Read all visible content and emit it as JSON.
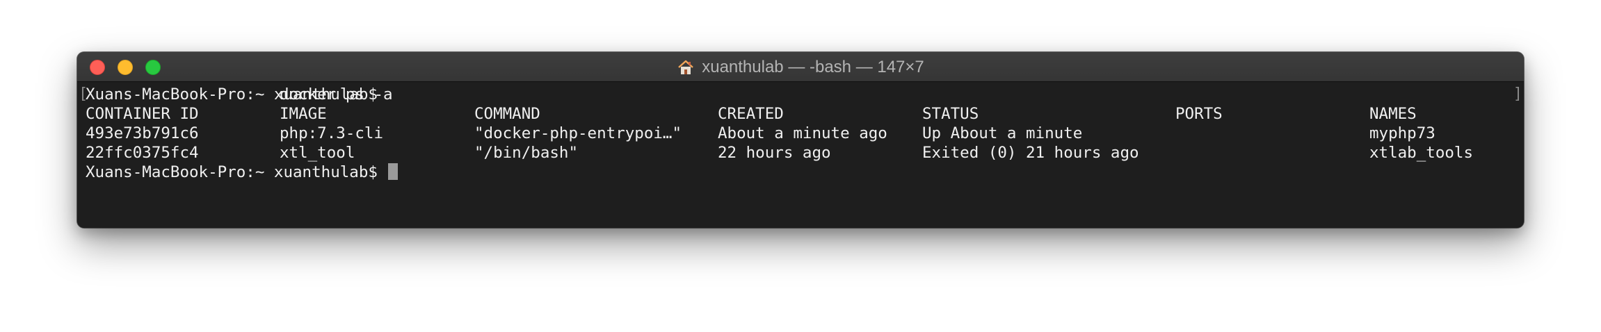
{
  "window": {
    "title": "xuanthulab — -bash — 147×7",
    "title_icon": "home-icon"
  },
  "terminal": {
    "command_line": {
      "prompt": "Xuans-MacBook-Pro:~ xuanthulab$",
      "command": "docker ps -a"
    },
    "table": {
      "headers": [
        "CONTAINER ID",
        "IMAGE",
        "COMMAND",
        "CREATED",
        "STATUS",
        "PORTS",
        "NAMES"
      ],
      "rows": [
        [
          "493e73b791c6",
          "php:7.3-cli",
          "\"docker-php-entrypoi…\"",
          "About a minute ago",
          "Up About a minute",
          "",
          "myphp73"
        ],
        [
          "22ffc0375fc4",
          "xtl_tool",
          "\"/bin/bash\"",
          "22 hours ago",
          "Exited (0) 21 hours ago",
          "",
          "xtlab_tools"
        ]
      ]
    },
    "current_prompt": "Xuans-MacBook-Pro:~ xuanthulab$"
  },
  "colors": {
    "background": "#1e1e1e",
    "text": "#f0f0f0",
    "close": "#fe5f57",
    "minimize": "#febc2e",
    "zoom": "#28c840"
  }
}
